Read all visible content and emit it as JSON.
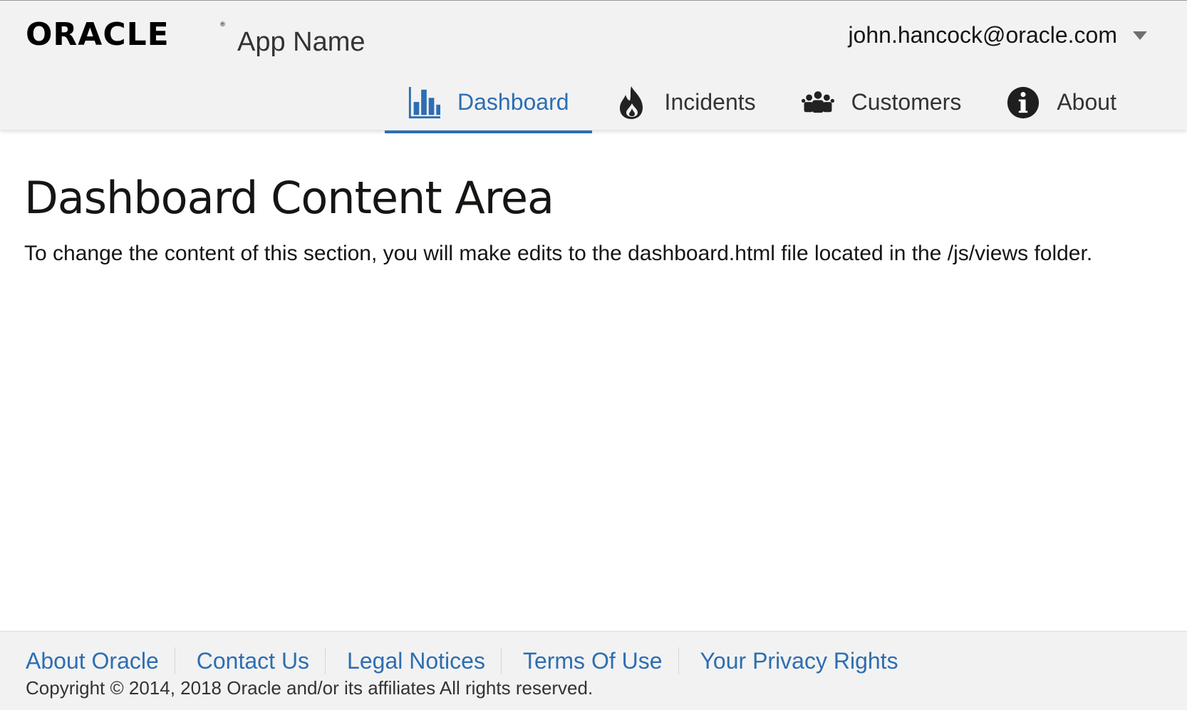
{
  "header": {
    "brand": {
      "logo_text": "ORACLE",
      "app_name": "App Name"
    },
    "user": {
      "email": "john.hancock@oracle.com"
    },
    "nav": [
      {
        "label": "Dashboard",
        "icon": "bar-chart-icon",
        "active": true
      },
      {
        "label": "Incidents",
        "icon": "fire-icon",
        "active": false
      },
      {
        "label": "Customers",
        "icon": "people-icon",
        "active": false
      },
      {
        "label": "About",
        "icon": "info-icon",
        "active": false
      }
    ]
  },
  "main": {
    "title": "Dashboard Content Area",
    "description": "To change the content of this section, you will make edits to the dashboard.html file located in the /js/views folder."
  },
  "footer": {
    "links": [
      {
        "label": "About Oracle"
      },
      {
        "label": "Contact Us"
      },
      {
        "label": "Legal Notices"
      },
      {
        "label": "Terms Of Use"
      },
      {
        "label": "Your Privacy Rights"
      }
    ],
    "copyright": "Copyright © 2014, 2018 Oracle and/or its affiliates All rights reserved."
  },
  "colors": {
    "accent": "#2d6eb1",
    "header_bg": "#f2f2f2",
    "text": "#161513"
  }
}
